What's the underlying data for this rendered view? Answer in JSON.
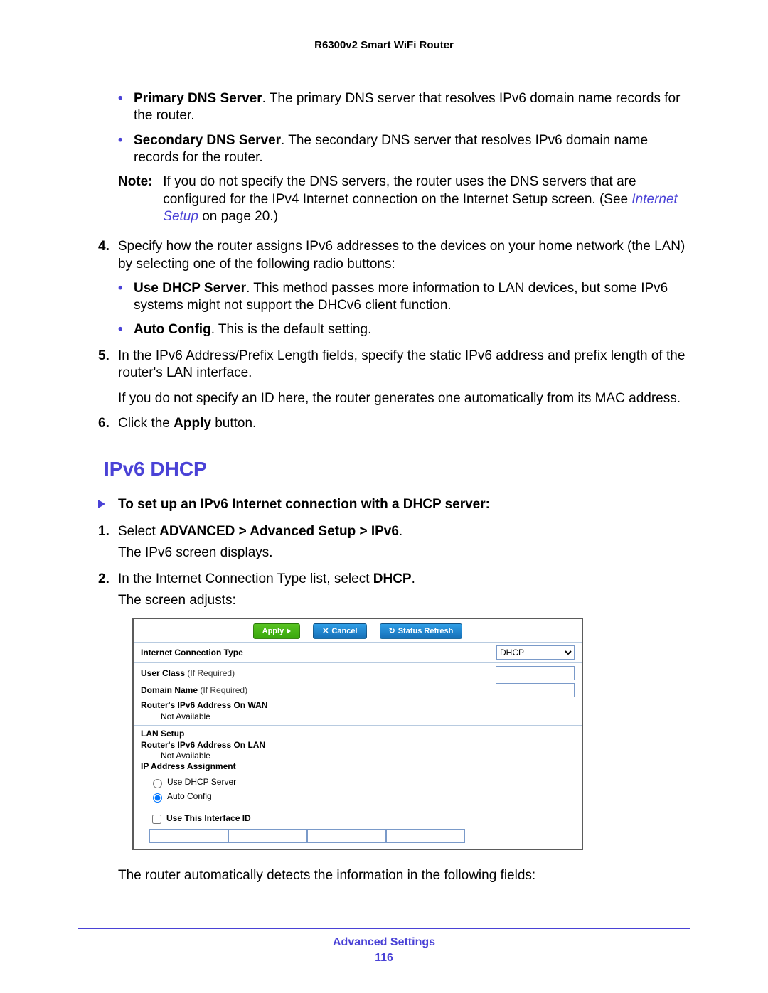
{
  "header": {
    "title": "R6300v2 Smart WiFi Router"
  },
  "bullets_top": [
    {
      "bold": "Primary DNS Server",
      "text": ". The primary DNS server that resolves IPv6 domain name records for the router."
    },
    {
      "bold": "Secondary DNS Server",
      "text": ". The secondary DNS server that resolves IPv6 domain name records for the router."
    }
  ],
  "note": {
    "label": "Note:",
    "text_1": "If you do not specify the DNS servers, the router uses the DNS servers that are configured for the IPv4 Internet connection on the Internet Setup screen. (See ",
    "link": "Internet Setup",
    "text_2": " on page 20.)"
  },
  "steps_a": [
    {
      "num": "4.",
      "text": "Specify how the router assigns IPv6 addresses to the devices on your home network (the LAN) by selecting one of the following radio buttons:",
      "bullets": [
        {
          "bold": "Use DHCP Server",
          "text": ". This method passes more information to LAN devices, but some IPv6 systems might not support the DHCv6 client function."
        },
        {
          "bold": "Auto Config",
          "text": ". This is the default setting."
        }
      ]
    },
    {
      "num": "5.",
      "text": "In the IPv6 Address/Prefix Length fields, specify the static IPv6 address and prefix length of the router's LAN interface.",
      "after": "If you do not specify an ID here, the router generates one automatically from its MAC address."
    },
    {
      "num": "6.",
      "text_pre": "Click the ",
      "bold": "Apply",
      "text_post": " button."
    }
  ],
  "section_title": "IPv6 DHCP",
  "procedure_lead": "To set up an IPv6 Internet connection with a DHCP server:",
  "steps_b": [
    {
      "num": "1.",
      "text_pre": "Select ",
      "bold": "ADVANCED > Advanced Setup > IPv6",
      "text_post": ".",
      "after": "The IPv6 screen displays."
    },
    {
      "num": "2.",
      "text_pre": "In the Internet Connection Type list, select ",
      "bold": "DHCP",
      "text_post": ".",
      "after": "The screen adjusts:"
    }
  ],
  "shot": {
    "buttons": {
      "apply": "Apply",
      "cancel": "Cancel",
      "refresh": "Status Refresh"
    },
    "conn_type_label": "Internet Connection Type",
    "conn_type_value": "DHCP",
    "user_class_label": "User Class",
    "if_required": "(If Required)",
    "domain_label": "Domain Name",
    "wan_label": "Router's IPv6 Address On WAN",
    "not_available": "Not Available",
    "lan_setup": "LAN Setup",
    "lan_label": "Router's IPv6 Address On LAN",
    "ipassign": "IP Address Assignment",
    "radio_dhcp": "Use DHCP Server",
    "radio_auto": "Auto Config",
    "use_iface": "Use This Interface ID"
  },
  "closing": "The router automatically detects the information in the following fields:",
  "footer": {
    "title": "Advanced Settings",
    "page": "116"
  }
}
